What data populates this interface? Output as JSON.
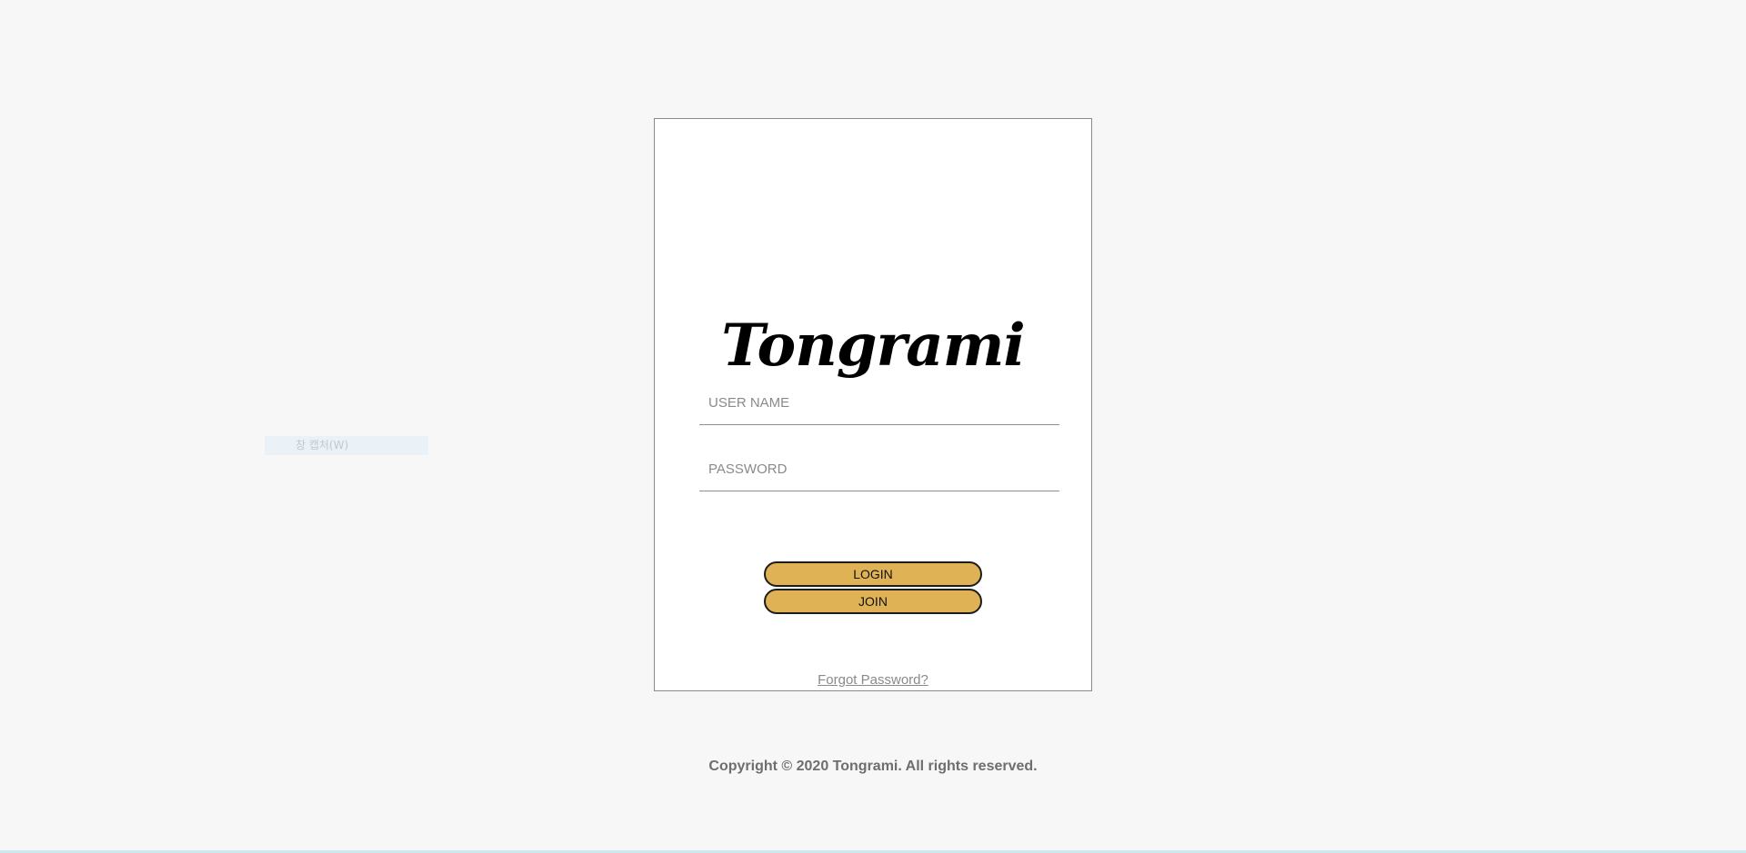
{
  "app": {
    "brand_name": "Tongrami"
  },
  "login_form": {
    "username_placeholder": "USER NAME",
    "password_placeholder": "PASSWORD",
    "login_label": "LOGIN",
    "join_label": "JOIN",
    "forgot_label": "Forgot Password?"
  },
  "footer": {
    "copyright": "Copyright © 2020 Tongrami. All rights reserved."
  },
  "overlay": {
    "faded_text": "창 캡처(W)"
  },
  "colors": {
    "page_background": "#f7f7f7",
    "card_background": "#ffffff",
    "button_fill": "#e0b256",
    "button_border": "#1d1d1d",
    "muted_text": "#8a8a8a",
    "footer_text": "#6e6e6e"
  }
}
